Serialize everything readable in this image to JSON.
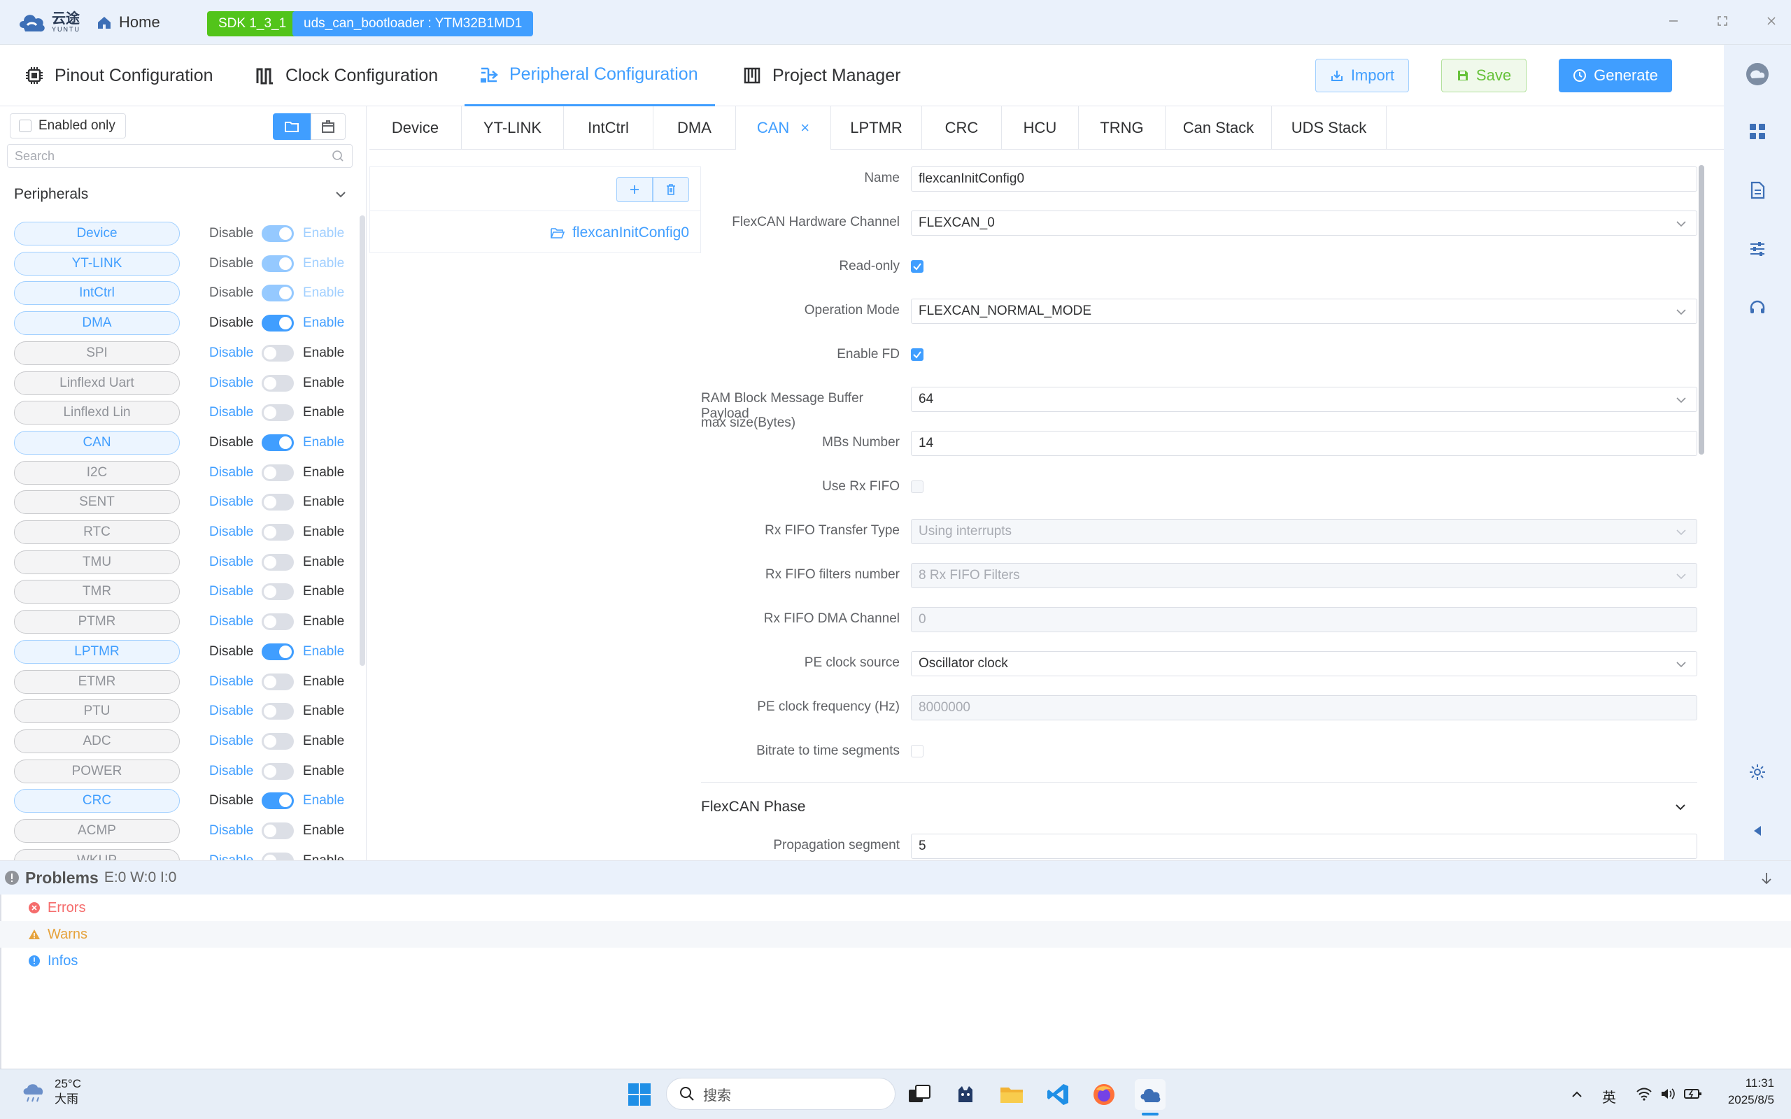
{
  "titlebar": {
    "logo_text": "云途",
    "logo_sub": "YUNTU",
    "home_label": "Home",
    "sdk_badge": "SDK 1_3_1",
    "project_badge": "uds_can_bootloader : YTM32B1MD1"
  },
  "topnav": {
    "tabs": [
      {
        "label": "Pinout Configuration",
        "icon": "chip-icon"
      },
      {
        "label": "Clock Configuration",
        "icon": "clock-wave-icon"
      },
      {
        "label": "Peripheral Configuration",
        "icon": "peripheral-icon",
        "active": true
      },
      {
        "label": "Project Manager",
        "icon": "project-icon"
      }
    ],
    "import_label": "Import",
    "save_label": "Save",
    "generate_label": "Generate"
  },
  "leftpanel": {
    "enabled_only_label": "Enabled only",
    "search_placeholder": "Search",
    "peripherals_header": "Peripherals",
    "disable_label": "Disable",
    "enable_label": "Enable",
    "items": [
      {
        "name": "Device",
        "enabled": true,
        "locked": true
      },
      {
        "name": "YT-LINK",
        "enabled": true,
        "locked": true
      },
      {
        "name": "IntCtrl",
        "enabled": true,
        "locked": true
      },
      {
        "name": "DMA",
        "enabled": true,
        "locked": false
      },
      {
        "name": "SPI",
        "enabled": false,
        "locked": false
      },
      {
        "name": "Linflexd Uart",
        "enabled": false,
        "locked": false
      },
      {
        "name": "Linflexd Lin",
        "enabled": false,
        "locked": false
      },
      {
        "name": "CAN",
        "enabled": true,
        "locked": false
      },
      {
        "name": "I2C",
        "enabled": false,
        "locked": false
      },
      {
        "name": "SENT",
        "enabled": false,
        "locked": false
      },
      {
        "name": "RTC",
        "enabled": false,
        "locked": false
      },
      {
        "name": "TMU",
        "enabled": false,
        "locked": false
      },
      {
        "name": "TMR",
        "enabled": false,
        "locked": false
      },
      {
        "name": "PTMR",
        "enabled": false,
        "locked": false
      },
      {
        "name": "LPTMR",
        "enabled": true,
        "locked": false
      },
      {
        "name": "ETMR",
        "enabled": false,
        "locked": false
      },
      {
        "name": "PTU",
        "enabled": false,
        "locked": false
      },
      {
        "name": "ADC",
        "enabled": false,
        "locked": false
      },
      {
        "name": "POWER",
        "enabled": false,
        "locked": false
      },
      {
        "name": "CRC",
        "enabled": true,
        "locked": false
      },
      {
        "name": "ACMP",
        "enabled": false,
        "locked": false
      },
      {
        "name": "WKUP",
        "enabled": false,
        "locked": false
      }
    ]
  },
  "ptabs": [
    {
      "label": "Device"
    },
    {
      "label": "YT-LINK"
    },
    {
      "label": "IntCtrl"
    },
    {
      "label": "DMA"
    },
    {
      "label": "CAN",
      "active": true,
      "closable": true
    },
    {
      "label": "LPTMR"
    },
    {
      "label": "CRC"
    },
    {
      "label": "HCU"
    },
    {
      "label": "TRNG"
    },
    {
      "label": "Can Stack"
    },
    {
      "label": "UDS Stack"
    }
  ],
  "configs": {
    "add_icon": "plus-icon",
    "delete_icon": "trash-icon",
    "item_label": "flexcanInitConfig0"
  },
  "form": {
    "name": {
      "label": "Name",
      "value": "flexcanInitConfig0"
    },
    "hw_channel": {
      "label": "FlexCAN Hardware Channel",
      "value": "FLEXCAN_0"
    },
    "read_only": {
      "label": "Read-only",
      "checked": true
    },
    "op_mode": {
      "label": "Operation Mode",
      "value": "FLEXCAN_NORMAL_MODE"
    },
    "enable_fd": {
      "label": "Enable FD",
      "checked": true
    },
    "payload": {
      "label_line1": "RAM Block Message Buffer Payload",
      "label_line2": "max size(Bytes)",
      "value": "64"
    },
    "mbs_number": {
      "label": "MBs Number",
      "value": "14"
    },
    "use_rx_fifo": {
      "label": "Use Rx FIFO",
      "checked": false
    },
    "rx_fifo_transfer": {
      "label": "Rx FIFO Transfer Type",
      "value": "Using interrupts"
    },
    "rx_fifo_filters": {
      "label": "Rx FIFO filters number",
      "value": "8 Rx FIFO Filters"
    },
    "rx_fifo_dma": {
      "label": "Rx FIFO DMA Channel",
      "value": "0"
    },
    "pe_clock_source": {
      "label": "PE clock source",
      "value": "Oscillator clock"
    },
    "pe_clock_freq": {
      "label": "PE clock frequency (Hz)",
      "value": "8000000"
    },
    "bitrate_segments": {
      "label": "Bitrate to time segments",
      "checked": false
    },
    "phase_title": "FlexCAN Phase",
    "prop_segment": {
      "label": "Propagation segment",
      "value": "5"
    }
  },
  "problems": {
    "title": "Problems",
    "counts": "E:0 W:0 I:0",
    "errors_label": "Errors",
    "warns_label": "Warns",
    "infos_label": "Infos"
  },
  "taskbar": {
    "temperature": "25°C",
    "weather": "大雨",
    "search_placeholder": "搜索",
    "ime": "英",
    "time": "11:31",
    "date": "2025/8/5"
  },
  "colors": {
    "accent": "#409eff",
    "success": "#52c41a",
    "error": "#f56c6c",
    "warning": "#e6a23c"
  }
}
